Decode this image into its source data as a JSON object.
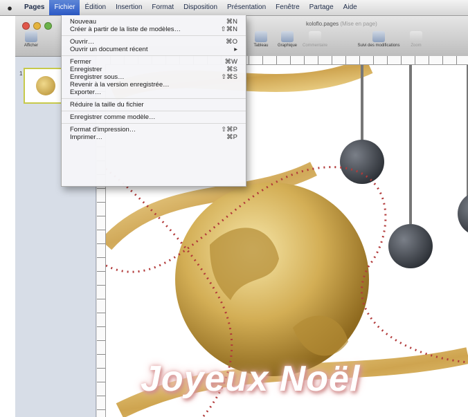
{
  "menubar": {
    "apple": "",
    "items": [
      "Pages",
      "Fichier",
      "Édition",
      "Insertion",
      "Format",
      "Disposition",
      "Présentation",
      "Fenêtre",
      "Partage",
      "Aide"
    ]
  },
  "window": {
    "title": "koloflo.pages",
    "title_sub": "(Mise en page)",
    "toolbar": {
      "afficher": "Afficher",
      "tableau": "Tableau",
      "graphique": "Graphique",
      "commentaire": "Commentaire",
      "suivi": "Suivi des modifications",
      "zoom": "Zoom"
    },
    "page_number": "1"
  },
  "menu": {
    "groups": [
      [
        {
          "label": "Nouveau",
          "shortcut": "⌘N"
        },
        {
          "label": "Créer à partir de la liste de modèles…",
          "shortcut": "⇧⌘N"
        }
      ],
      [
        {
          "label": "Ouvrir…",
          "shortcut": "⌘O"
        },
        {
          "label": "Ouvrir un document récent",
          "shortcut": "▸"
        }
      ],
      [
        {
          "label": "Fermer",
          "shortcut": "⌘W"
        },
        {
          "label": "Enregistrer",
          "shortcut": "⌘S"
        },
        {
          "label": "Enregistrer sous…",
          "shortcut": "⇧⌘S"
        },
        {
          "label": "Revenir à la version enregistrée…",
          "shortcut": ""
        },
        {
          "label": "Exporter…",
          "shortcut": ""
        }
      ],
      [
        {
          "label": "Réduire la taille du fichier",
          "shortcut": ""
        }
      ],
      [
        {
          "label": "Enregistrer comme modèle…",
          "shortcut": ""
        }
      ],
      [
        {
          "label": "Format d'impression…",
          "shortcut": "⇧⌘P"
        },
        {
          "label": "Imprimer…",
          "shortcut": "⌘P"
        }
      ]
    ]
  },
  "document": {
    "greeting": "Joyeux Noël"
  },
  "colors": {
    "menu_highlight": "#3a66cc",
    "gold": "#c9a24a",
    "ornament": "#3d4148",
    "beads": "#b23a3a"
  }
}
